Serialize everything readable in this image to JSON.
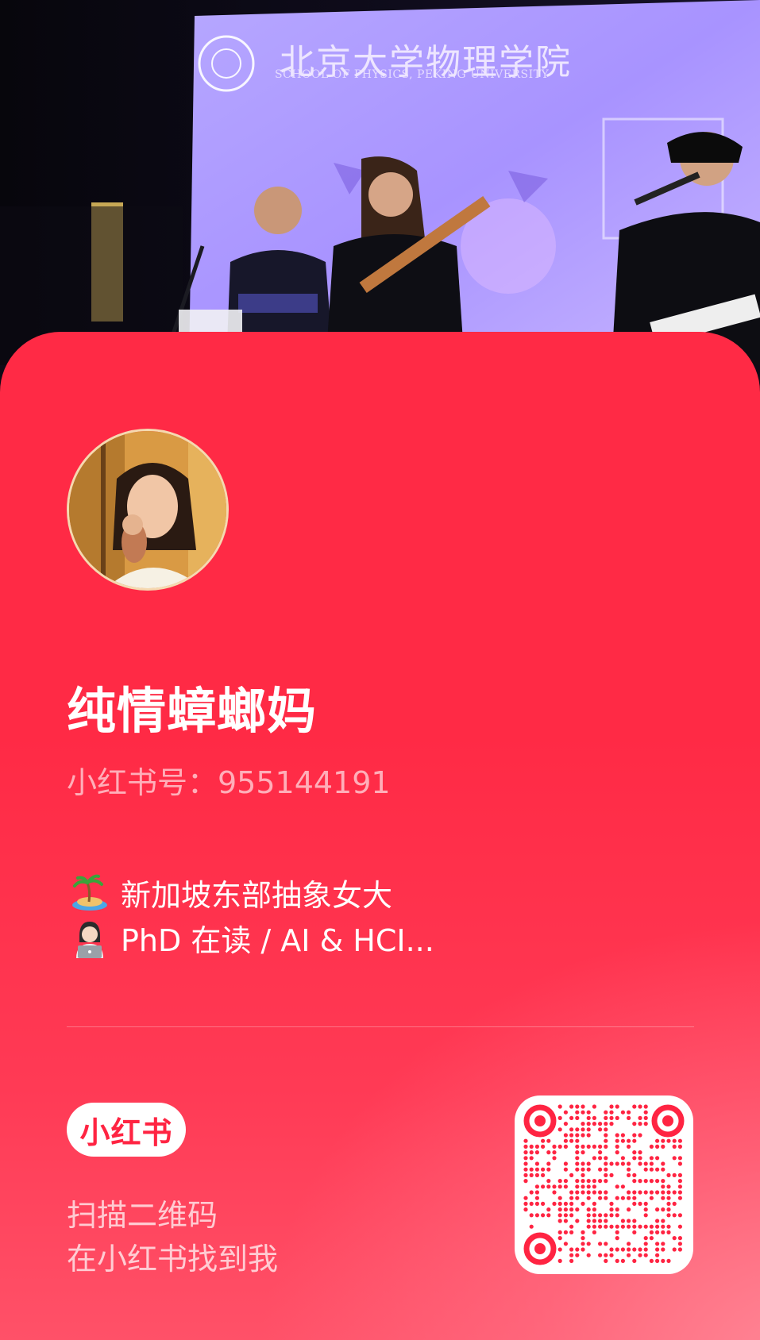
{
  "background_photo": {
    "banner_cn": "北京大学物理学院",
    "banner_en": "SCHOOL OF PHYSICS, PEKING UNIVERSITY"
  },
  "profile": {
    "name": "纯情蟑螂妈",
    "red_id": "小红书号：955144191",
    "bio": [
      {
        "icon": "desert-island-icon",
        "text": "新加坡东部抽象女大"
      },
      {
        "icon": "technologist-icon",
        "text": "PhD 在读 / AI & HCI..."
      }
    ]
  },
  "footer": {
    "logo": "小红书",
    "scan_line_1": "扫描二维码",
    "scan_line_2": "在小红书找到我"
  },
  "colors": {
    "card_red": "#ff2a45",
    "brand_red": "#ff2442",
    "white": "#ffffff"
  }
}
